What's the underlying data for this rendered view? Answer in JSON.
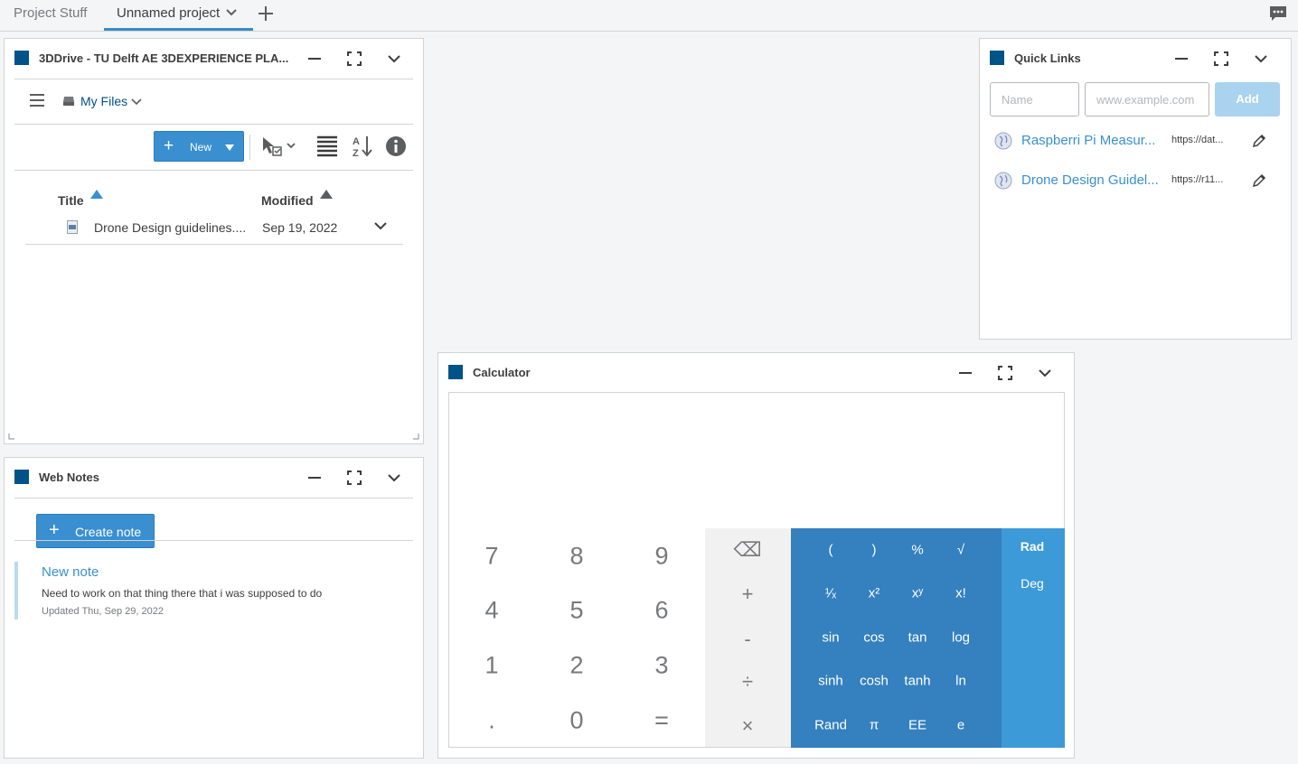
{
  "tabs": [
    {
      "label": "Project Stuff"
    },
    {
      "label": "Unnamed project"
    }
  ],
  "drive": {
    "title": "3DDrive - TU Delft AE 3DEXPERIENCE PLA...",
    "location": "My Files",
    "new_label": "New",
    "columns": {
      "title": "Title",
      "modified": "Modified"
    },
    "files": [
      {
        "title": "Drone Design guidelines....",
        "modified": "Sep 19, 2022"
      }
    ]
  },
  "notes": {
    "title": "Web Notes",
    "create_label": "Create note",
    "items": [
      {
        "title": "New note",
        "body": "Need to work on that thing there that i was supposed to do",
        "updated": "Updated Thu, Sep 29, 2022"
      }
    ]
  },
  "quicklinks": {
    "title": "Quick Links",
    "name_placeholder": "Name",
    "url_placeholder": "www.example.com",
    "add_label": "Add",
    "links": [
      {
        "name": "Raspberri Pi Measur...",
        "url": "https://dat..."
      },
      {
        "name": "Drone Design Guidel...",
        "url": "https://r11..."
      }
    ]
  },
  "calculator": {
    "title": "Calculator",
    "display": "",
    "numbers": [
      "7",
      "8",
      "9",
      "4",
      "5",
      "6",
      "1",
      "2",
      "3",
      ".",
      "0",
      "="
    ],
    "ops": [
      "⌫",
      "+",
      "-",
      "÷",
      "×"
    ],
    "sci": [
      "(",
      ")",
      "%",
      "√",
      "¹⁄ₓ",
      "x²",
      "xʸ",
      "x!",
      "sin",
      "cos",
      "tan",
      "log",
      "sinh",
      "cosh",
      "tanh",
      "ln",
      "Rand",
      "π",
      "EE",
      "e"
    ],
    "modes": [
      "Rad",
      "Deg"
    ],
    "selected_mode": "Rad"
  },
  "colors": {
    "accent": "#3a8fd0",
    "brand": "#005386",
    "sci_pad": "#3580bf",
    "mode_pad": "#3d9ad9"
  }
}
